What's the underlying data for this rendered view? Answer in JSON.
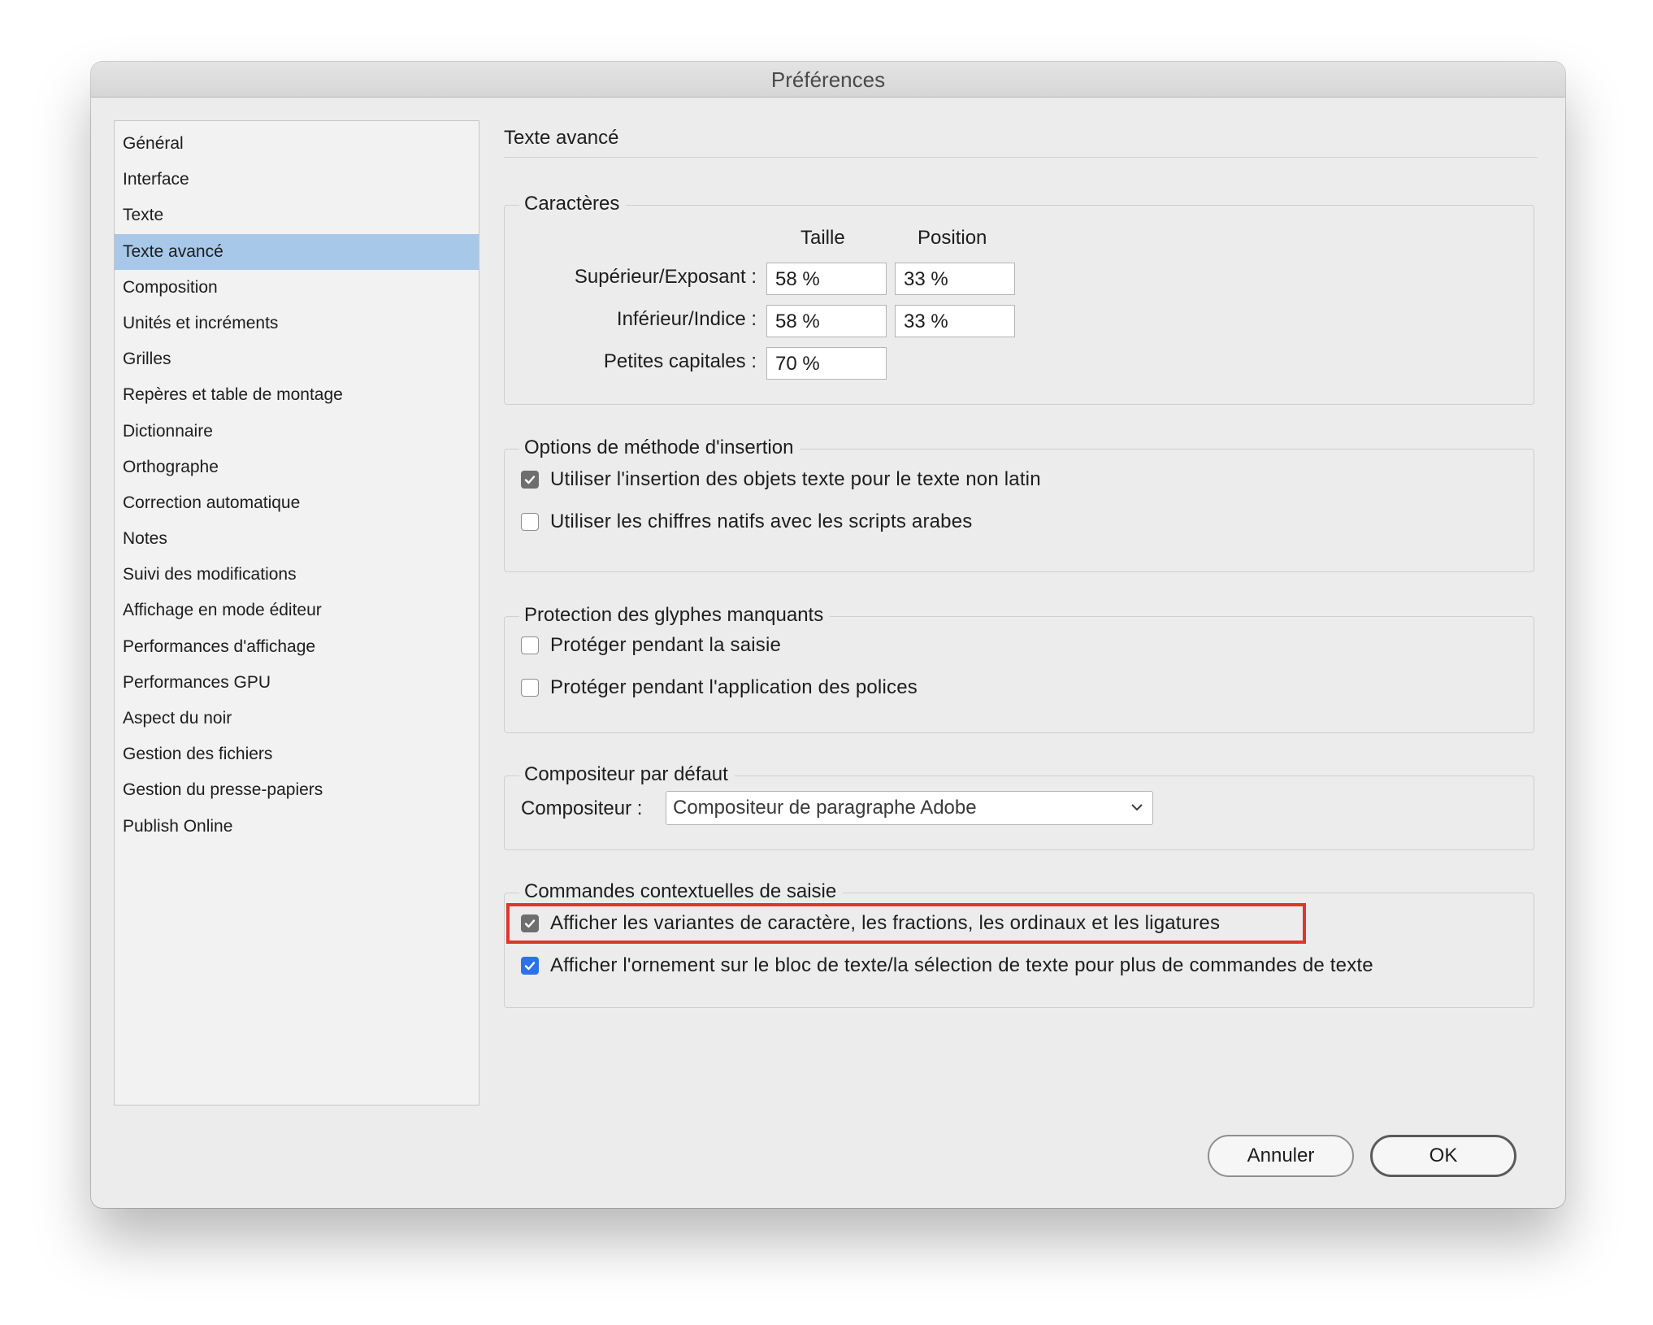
{
  "window": {
    "title": "Préférences"
  },
  "sidebar": {
    "items": [
      {
        "label": "Général"
      },
      {
        "label": "Interface"
      },
      {
        "label": "Texte"
      },
      {
        "label": "Texte avancé",
        "selected": true
      },
      {
        "label": "Composition"
      },
      {
        "label": "Unités et incréments"
      },
      {
        "label": "Grilles"
      },
      {
        "label": "Repères et table de montage"
      },
      {
        "label": "Dictionnaire"
      },
      {
        "label": "Orthographe"
      },
      {
        "label": "Correction automatique"
      },
      {
        "label": "Notes"
      },
      {
        "label": "Suivi des modifications"
      },
      {
        "label": "Affichage en mode éditeur"
      },
      {
        "label": "Performances d'affichage"
      },
      {
        "label": "Performances GPU"
      },
      {
        "label": "Aspect du noir"
      },
      {
        "label": "Gestion des fichiers"
      },
      {
        "label": "Gestion du presse-papiers"
      },
      {
        "label": "Publish Online"
      }
    ]
  },
  "main": {
    "title": "Texte avancé",
    "characters": {
      "legend": "Caractères",
      "col_size": "Taille",
      "col_position": "Position",
      "superscript_label": "Supérieur/Exposant :",
      "superscript_size": "58 %",
      "superscript_position": "33 %",
      "subscript_label": "Inférieur/Indice :",
      "subscript_size": "58 %",
      "subscript_position": "33 %",
      "smallcaps_label": "Petites capitales :",
      "smallcaps_size": "70 %"
    },
    "input_method": {
      "legend": "Options de méthode d'insertion",
      "option1": "Utiliser l'insertion des objets texte pour le texte non latin",
      "option1_checked": true,
      "option2": "Utiliser les chiffres natifs avec les scripts arabes",
      "option2_checked": false
    },
    "missing_glyph": {
      "legend": "Protection des glyphes manquants",
      "option1": "Protéger pendant la saisie",
      "option1_checked": false,
      "option2": "Protéger pendant l'application des polices",
      "option2_checked": false
    },
    "composer": {
      "legend": "Compositeur par défaut",
      "label": "Compositeur :",
      "selected": "Compositeur de paragraphe Adobe"
    },
    "contextual": {
      "legend": "Commandes contextuelles de saisie",
      "option1": "Afficher les variantes de caractère, les fractions, les ordinaux et les ligatures",
      "option1_checked": true,
      "option2": "Afficher l'ornement sur le bloc de texte/la sélection de texte pour plus de commandes de texte",
      "option2_checked": true
    }
  },
  "buttons": {
    "cancel": "Annuler",
    "ok": "OK"
  },
  "colors": {
    "selection": "#a8c8ea",
    "accent": "#2b72e6",
    "highlight": "#e0352b"
  }
}
